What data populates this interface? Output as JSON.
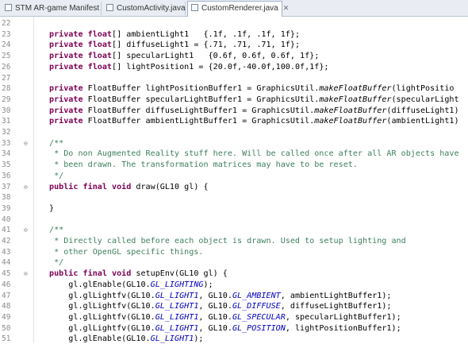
{
  "tabs": [
    {
      "label": "STM AR-game Manifest",
      "active": false
    },
    {
      "label": "CustomActivity.java",
      "active": false
    },
    {
      "label": "CustomRenderer.java",
      "active": true
    }
  ],
  "close_glyph": "✕",
  "lines": [
    {
      "n": "22",
      "fold": "",
      "tokens": []
    },
    {
      "n": "23",
      "fold": "",
      "tokens": [
        {
          "t": "kw",
          "v": "private float"
        },
        {
          "t": "",
          "v": "[] ambientLight1   {.1f, .1f, .1f, 1f};"
        }
      ]
    },
    {
      "n": "24",
      "fold": "",
      "tokens": [
        {
          "t": "kw",
          "v": "private float"
        },
        {
          "t": "",
          "v": "[] diffuseLight1 = {.71, .71, .71, 1f};"
        }
      ]
    },
    {
      "n": "25",
      "fold": "",
      "tokens": [
        {
          "t": "kw",
          "v": "private float"
        },
        {
          "t": "",
          "v": "[] specularLight1   {0.6f, 0.6f, 0.6f, 1f};"
        }
      ]
    },
    {
      "n": "26",
      "fold": "",
      "tokens": [
        {
          "t": "kw",
          "v": "private float"
        },
        {
          "t": "",
          "v": "[] lightPosition1 = {20.0f,-40.0f,100.0f,1f};"
        }
      ]
    },
    {
      "n": "27",
      "fold": "",
      "tokens": []
    },
    {
      "n": "28",
      "fold": "",
      "tokens": [
        {
          "t": "kw",
          "v": "private"
        },
        {
          "t": "",
          "v": " FloatBuffer lightPositionBuffer1 = GraphicsUtil."
        },
        {
          "t": "fn",
          "v": "makeFloatBuffer"
        },
        {
          "t": "",
          "v": "(lightPositio"
        }
      ]
    },
    {
      "n": "29",
      "fold": "",
      "tokens": [
        {
          "t": "kw",
          "v": "private"
        },
        {
          "t": "",
          "v": " FloatBuffer specularLightBuffer1 = GraphicsUtil."
        },
        {
          "t": "fn",
          "v": "makeFloatBuffer"
        },
        {
          "t": "",
          "v": "(specularLight"
        }
      ]
    },
    {
      "n": "30",
      "fold": "",
      "tokens": [
        {
          "t": "kw",
          "v": "private"
        },
        {
          "t": "",
          "v": " FloatBuffer diffuseLightBuffer1 = GraphicsUtil."
        },
        {
          "t": "fn",
          "v": "makeFloatBuffer"
        },
        {
          "t": "",
          "v": "(diffuseLight1)"
        }
      ]
    },
    {
      "n": "31",
      "fold": "",
      "tokens": [
        {
          "t": "kw",
          "v": "private"
        },
        {
          "t": "",
          "v": " FloatBuffer ambientLightBuffer1 = GraphicsUtil."
        },
        {
          "t": "fn",
          "v": "makeFloatBuffer"
        },
        {
          "t": "",
          "v": "(ambientLight1)"
        }
      ]
    },
    {
      "n": "32",
      "fold": "",
      "tokens": []
    },
    {
      "n": "33",
      "fold": "⊖",
      "tokens": [
        {
          "t": "cm",
          "v": "/**"
        }
      ]
    },
    {
      "n": "34",
      "fold": "",
      "tokens": [
        {
          "t": "cm",
          "v": " * Do non Augmented Reality stuff here. Will be called once after all AR objects have"
        }
      ]
    },
    {
      "n": "35",
      "fold": "",
      "tokens": [
        {
          "t": "cm",
          "v": " * been drawn. The transformation matrices may have to be reset."
        }
      ]
    },
    {
      "n": "36",
      "fold": "",
      "tokens": [
        {
          "t": "cm",
          "v": " */"
        }
      ]
    },
    {
      "n": "37",
      "fold": "⊖",
      "tokens": [
        {
          "t": "kw",
          "v": "public final void"
        },
        {
          "t": "",
          "v": " draw(GL10 gl) {"
        }
      ]
    },
    {
      "n": "38",
      "fold": "",
      "tokens": []
    },
    {
      "n": "39",
      "fold": "",
      "tokens": [
        {
          "t": "",
          "v": "}"
        }
      ]
    },
    {
      "n": "40",
      "fold": "",
      "tokens": []
    },
    {
      "n": "41",
      "fold": "⊖",
      "tokens": [
        {
          "t": "cm",
          "v": "/**"
        }
      ]
    },
    {
      "n": "42",
      "fold": "",
      "tokens": [
        {
          "t": "cm",
          "v": " * Directly called before each object is drawn. Used to setup lighting and"
        }
      ]
    },
    {
      "n": "43",
      "fold": "",
      "tokens": [
        {
          "t": "cm",
          "v": " * other OpenGL specific things."
        }
      ]
    },
    {
      "n": "44",
      "fold": "",
      "tokens": [
        {
          "t": "cm",
          "v": " */"
        }
      ]
    },
    {
      "n": "45",
      "fold": "⊖",
      "tokens": [
        {
          "t": "kw",
          "v": "public final void"
        },
        {
          "t": "",
          "v": " setupEnv(GL10 gl) {"
        }
      ]
    },
    {
      "n": "46",
      "fold": "",
      "tokens": [
        {
          "t": "",
          "v": "    gl.glEnable(GL10."
        },
        {
          "t": "st",
          "v": "GL_LIGHTING"
        },
        {
          "t": "",
          "v": ");"
        }
      ]
    },
    {
      "n": "47",
      "fold": "",
      "tokens": [
        {
          "t": "",
          "v": "    gl.glLightfv(GL10."
        },
        {
          "t": "st",
          "v": "GL_LIGHT1"
        },
        {
          "t": "",
          "v": ", GL10."
        },
        {
          "t": "st",
          "v": "GL_AMBIENT"
        },
        {
          "t": "",
          "v": ", ambientLightBuffer1);"
        }
      ]
    },
    {
      "n": "48",
      "fold": "",
      "tokens": [
        {
          "t": "",
          "v": "    gl.glLightfv(GL10."
        },
        {
          "t": "st",
          "v": "GL_LIGHT1"
        },
        {
          "t": "",
          "v": ", GL10."
        },
        {
          "t": "st",
          "v": "GL_DIFFUSE"
        },
        {
          "t": "",
          "v": ", diffuseLightBuffer1);"
        }
      ]
    },
    {
      "n": "49",
      "fold": "",
      "tokens": [
        {
          "t": "",
          "v": "    gl.glLightfv(GL10."
        },
        {
          "t": "st",
          "v": "GL_LIGHT1"
        },
        {
          "t": "",
          "v": ", GL10."
        },
        {
          "t": "st",
          "v": "GL_SPECULAR"
        },
        {
          "t": "",
          "v": ", specularLightBuffer1);"
        }
      ]
    },
    {
      "n": "50",
      "fold": "",
      "tokens": [
        {
          "t": "",
          "v": "    gl.glLightfv(GL10."
        },
        {
          "t": "st",
          "v": "GL_LIGHT1"
        },
        {
          "t": "",
          "v": ", GL10."
        },
        {
          "t": "st",
          "v": "GL_POSITION"
        },
        {
          "t": "",
          "v": ", lightPositionBuffer1);"
        }
      ]
    },
    {
      "n": "51",
      "fold": "",
      "tokens": [
        {
          "t": "",
          "v": "    gl.glEnable(GL10."
        },
        {
          "t": "st",
          "v": "GL_LIGHT1"
        },
        {
          "t": "",
          "v": ");"
        }
      ]
    }
  ]
}
